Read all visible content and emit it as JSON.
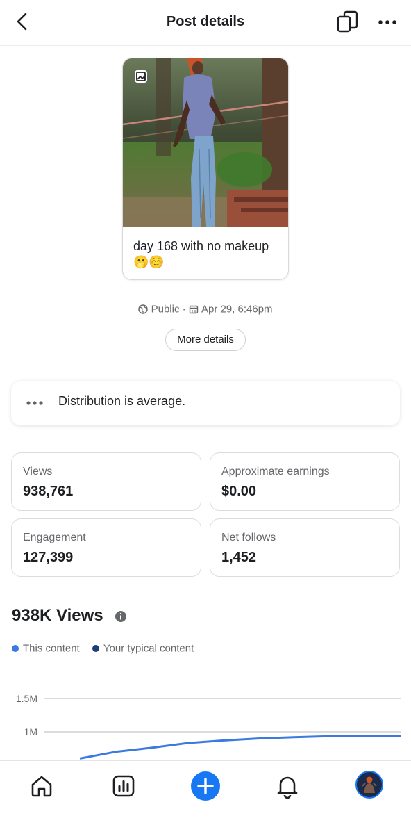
{
  "header": {
    "title": "Post details",
    "back_icon": "chevron-left-icon",
    "copy_icon": "copy-icon",
    "more_icon": "more-horizontal-icon"
  },
  "post": {
    "caption": "day 168 with no makeup 🫢☺️",
    "media_icon": "photo-icon",
    "visibility": "Public",
    "separator": "·",
    "date": "Apr 29, 6:46pm"
  },
  "more_details_label": "More details",
  "distribution": {
    "text": "Distribution is average."
  },
  "stats": [
    {
      "label": "Views",
      "value": "938,761"
    },
    {
      "label": "Approximate earnings",
      "value": "$0.00"
    },
    {
      "label": "Engagement",
      "value": "127,399"
    },
    {
      "label": "Net follows",
      "value": "1,452"
    }
  ],
  "views_section": {
    "title": "938K Views",
    "legend": [
      {
        "name": "This content",
        "color": "#3b7ae0"
      },
      {
        "name": "Your typical content",
        "color": "#1c3f7a"
      }
    ]
  },
  "chart_data": {
    "type": "line",
    "y_ticks": [
      "1.5M",
      "1M"
    ],
    "series": [
      {
        "name": "This content",
        "color": "#3b7ae0",
        "values": [
          600000,
          700000,
          760000,
          830000,
          870000,
          900000,
          920000,
          935000,
          938000,
          938761
        ]
      },
      {
        "name": "Your typical content",
        "color": "#1c3f7a",
        "values": []
      }
    ],
    "ylim": [
      500000,
      1500000
    ],
    "grid": true
  },
  "bottom_nav": [
    {
      "name": "home",
      "icon": "home-icon"
    },
    {
      "name": "insights",
      "icon": "bar-chart-icon"
    },
    {
      "name": "create",
      "icon": "plus-icon",
      "color": "#1877f2"
    },
    {
      "name": "notifications",
      "icon": "bell-icon"
    },
    {
      "name": "profile",
      "icon": "avatar"
    }
  ]
}
